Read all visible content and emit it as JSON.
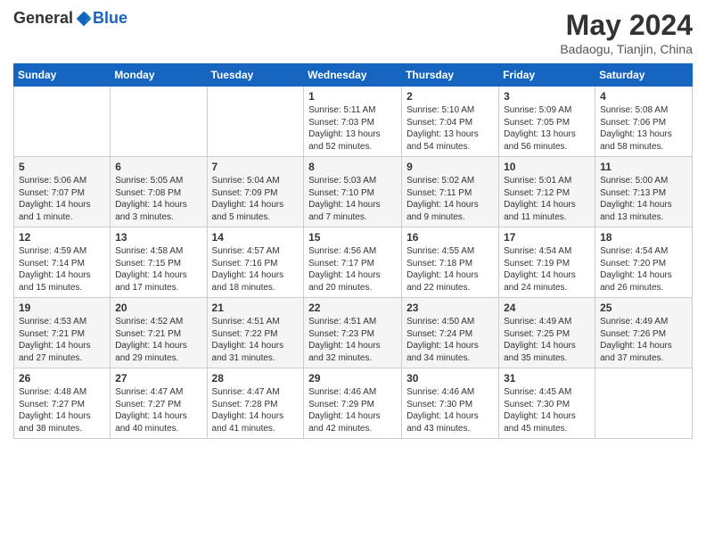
{
  "header": {
    "logo_general": "General",
    "logo_blue": "Blue",
    "month_title": "May 2024",
    "location": "Badaogu, Tianjin, China"
  },
  "days_of_week": [
    "Sunday",
    "Monday",
    "Tuesday",
    "Wednesday",
    "Thursday",
    "Friday",
    "Saturday"
  ],
  "weeks": [
    [
      {
        "day": "",
        "info": ""
      },
      {
        "day": "",
        "info": ""
      },
      {
        "day": "",
        "info": ""
      },
      {
        "day": "1",
        "info": "Sunrise: 5:11 AM\nSunset: 7:03 PM\nDaylight: 13 hours and 52 minutes."
      },
      {
        "day": "2",
        "info": "Sunrise: 5:10 AM\nSunset: 7:04 PM\nDaylight: 13 hours and 54 minutes."
      },
      {
        "day": "3",
        "info": "Sunrise: 5:09 AM\nSunset: 7:05 PM\nDaylight: 13 hours and 56 minutes."
      },
      {
        "day": "4",
        "info": "Sunrise: 5:08 AM\nSunset: 7:06 PM\nDaylight: 13 hours and 58 minutes."
      }
    ],
    [
      {
        "day": "5",
        "info": "Sunrise: 5:06 AM\nSunset: 7:07 PM\nDaylight: 14 hours and 1 minute."
      },
      {
        "day": "6",
        "info": "Sunrise: 5:05 AM\nSunset: 7:08 PM\nDaylight: 14 hours and 3 minutes."
      },
      {
        "day": "7",
        "info": "Sunrise: 5:04 AM\nSunset: 7:09 PM\nDaylight: 14 hours and 5 minutes."
      },
      {
        "day": "8",
        "info": "Sunrise: 5:03 AM\nSunset: 7:10 PM\nDaylight: 14 hours and 7 minutes."
      },
      {
        "day": "9",
        "info": "Sunrise: 5:02 AM\nSunset: 7:11 PM\nDaylight: 14 hours and 9 minutes."
      },
      {
        "day": "10",
        "info": "Sunrise: 5:01 AM\nSunset: 7:12 PM\nDaylight: 14 hours and 11 minutes."
      },
      {
        "day": "11",
        "info": "Sunrise: 5:00 AM\nSunset: 7:13 PM\nDaylight: 14 hours and 13 minutes."
      }
    ],
    [
      {
        "day": "12",
        "info": "Sunrise: 4:59 AM\nSunset: 7:14 PM\nDaylight: 14 hours and 15 minutes."
      },
      {
        "day": "13",
        "info": "Sunrise: 4:58 AM\nSunset: 7:15 PM\nDaylight: 14 hours and 17 minutes."
      },
      {
        "day": "14",
        "info": "Sunrise: 4:57 AM\nSunset: 7:16 PM\nDaylight: 14 hours and 18 minutes."
      },
      {
        "day": "15",
        "info": "Sunrise: 4:56 AM\nSunset: 7:17 PM\nDaylight: 14 hours and 20 minutes."
      },
      {
        "day": "16",
        "info": "Sunrise: 4:55 AM\nSunset: 7:18 PM\nDaylight: 14 hours and 22 minutes."
      },
      {
        "day": "17",
        "info": "Sunrise: 4:54 AM\nSunset: 7:19 PM\nDaylight: 14 hours and 24 minutes."
      },
      {
        "day": "18",
        "info": "Sunrise: 4:54 AM\nSunset: 7:20 PM\nDaylight: 14 hours and 26 minutes."
      }
    ],
    [
      {
        "day": "19",
        "info": "Sunrise: 4:53 AM\nSunset: 7:21 PM\nDaylight: 14 hours and 27 minutes."
      },
      {
        "day": "20",
        "info": "Sunrise: 4:52 AM\nSunset: 7:21 PM\nDaylight: 14 hours and 29 minutes."
      },
      {
        "day": "21",
        "info": "Sunrise: 4:51 AM\nSunset: 7:22 PM\nDaylight: 14 hours and 31 minutes."
      },
      {
        "day": "22",
        "info": "Sunrise: 4:51 AM\nSunset: 7:23 PM\nDaylight: 14 hours and 32 minutes."
      },
      {
        "day": "23",
        "info": "Sunrise: 4:50 AM\nSunset: 7:24 PM\nDaylight: 14 hours and 34 minutes."
      },
      {
        "day": "24",
        "info": "Sunrise: 4:49 AM\nSunset: 7:25 PM\nDaylight: 14 hours and 35 minutes."
      },
      {
        "day": "25",
        "info": "Sunrise: 4:49 AM\nSunset: 7:26 PM\nDaylight: 14 hours and 37 minutes."
      }
    ],
    [
      {
        "day": "26",
        "info": "Sunrise: 4:48 AM\nSunset: 7:27 PM\nDaylight: 14 hours and 38 minutes."
      },
      {
        "day": "27",
        "info": "Sunrise: 4:47 AM\nSunset: 7:27 PM\nDaylight: 14 hours and 40 minutes."
      },
      {
        "day": "28",
        "info": "Sunrise: 4:47 AM\nSunset: 7:28 PM\nDaylight: 14 hours and 41 minutes."
      },
      {
        "day": "29",
        "info": "Sunrise: 4:46 AM\nSunset: 7:29 PM\nDaylight: 14 hours and 42 minutes."
      },
      {
        "day": "30",
        "info": "Sunrise: 4:46 AM\nSunset: 7:30 PM\nDaylight: 14 hours and 43 minutes."
      },
      {
        "day": "31",
        "info": "Sunrise: 4:45 AM\nSunset: 7:30 PM\nDaylight: 14 hours and 45 minutes."
      },
      {
        "day": "",
        "info": ""
      }
    ]
  ]
}
